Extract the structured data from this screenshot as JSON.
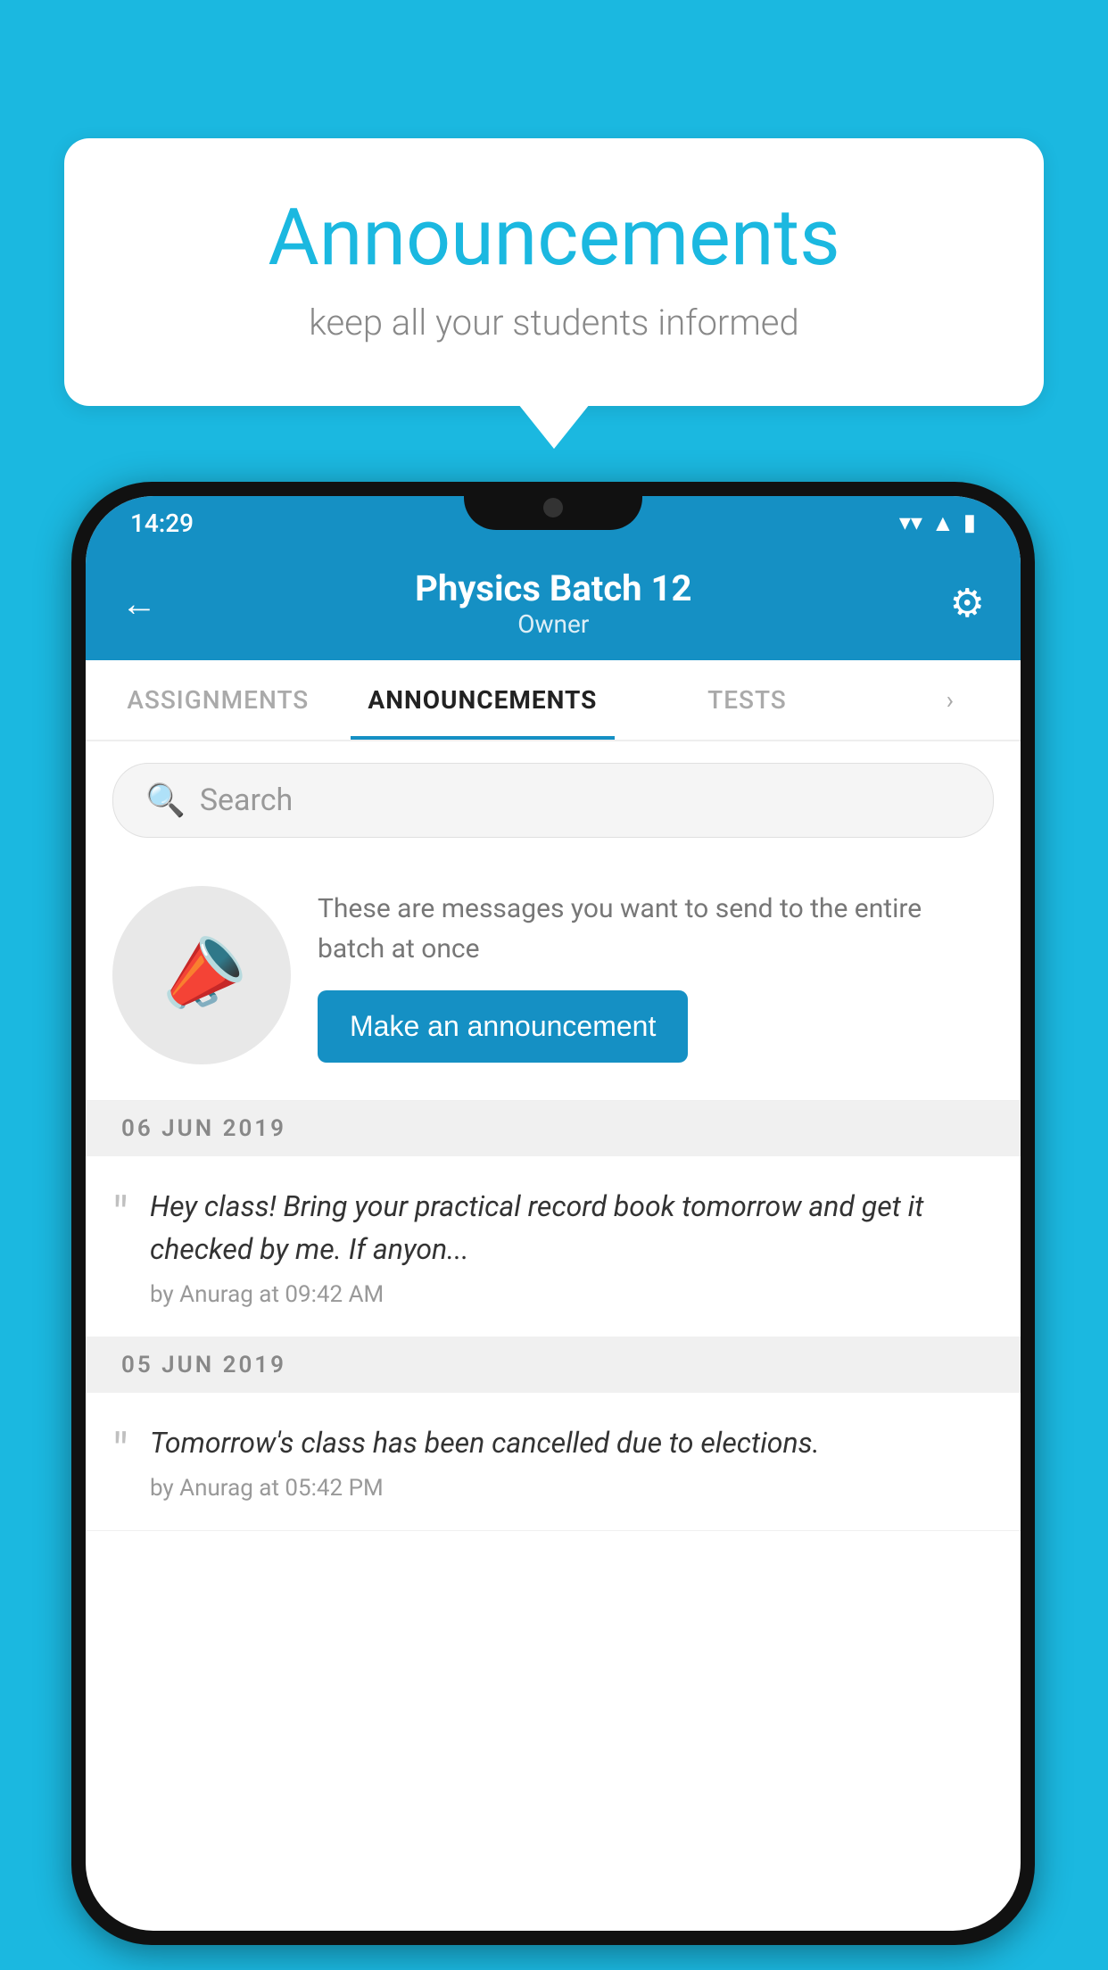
{
  "background_color": "#1bb8e0",
  "speech_bubble": {
    "title": "Announcements",
    "subtitle": "keep all your students informed"
  },
  "phone": {
    "status_bar": {
      "time": "14:29",
      "icons": [
        "wifi",
        "signal",
        "battery"
      ]
    },
    "header": {
      "title": "Physics Batch 12",
      "subtitle": "Owner",
      "back_label": "←",
      "settings_label": "⚙"
    },
    "tabs": [
      {
        "label": "ASSIGNMENTS",
        "active": false
      },
      {
        "label": "ANNOUNCEMENTS",
        "active": true
      },
      {
        "label": "TESTS",
        "active": false
      },
      {
        "label": "›",
        "active": false
      }
    ],
    "search": {
      "placeholder": "Search"
    },
    "promo": {
      "description": "These are messages you want to send to the entire batch at once",
      "button_label": "Make an announcement"
    },
    "announcements": [
      {
        "date": "06  JUN  2019",
        "text": "Hey class! Bring your practical record book tomorrow and get it checked by me. If anyon...",
        "author": "by Anurag at 09:42 AM"
      },
      {
        "date": "05  JUN  2019",
        "text": "Tomorrow's class has been cancelled due to elections.",
        "author": "by Anurag at 05:42 PM"
      }
    ]
  }
}
